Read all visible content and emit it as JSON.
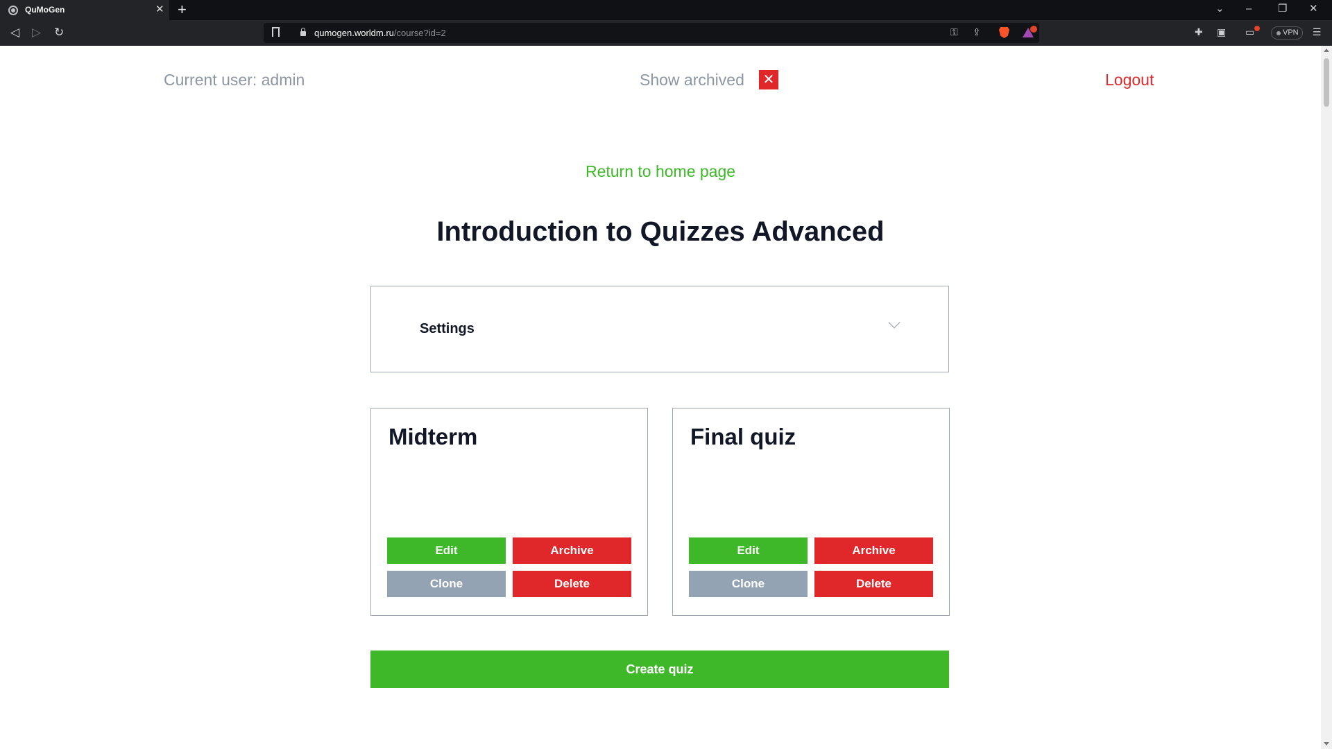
{
  "browser": {
    "tab_title": "QuMoGen",
    "url_host": "qumogen.worldm.ru",
    "url_path": "/course?id=2",
    "vpn_label": "VPN"
  },
  "header": {
    "current_user": "Current user: admin",
    "show_archived_label": "Show archived",
    "show_archived_checked": true,
    "logout_label": "Logout"
  },
  "main": {
    "home_link": "Return to home page",
    "course_title": "Introduction to Quizzes Advanced",
    "settings_label": "Settings",
    "quizzes": [
      {
        "title": "Midterm",
        "edit_label": "Edit",
        "archive_label": "Archive",
        "clone_label": "Clone",
        "delete_label": "Delete"
      },
      {
        "title": "Final quiz",
        "edit_label": "Edit",
        "archive_label": "Archive",
        "clone_label": "Clone",
        "delete_label": "Delete"
      }
    ],
    "create_quiz_label": "Create quiz"
  },
  "colors": {
    "green": "#3eb829",
    "red": "#e0282a",
    "grey_button": "#94a3b3",
    "muted_text": "#8d96a3",
    "heading": "#111726"
  }
}
